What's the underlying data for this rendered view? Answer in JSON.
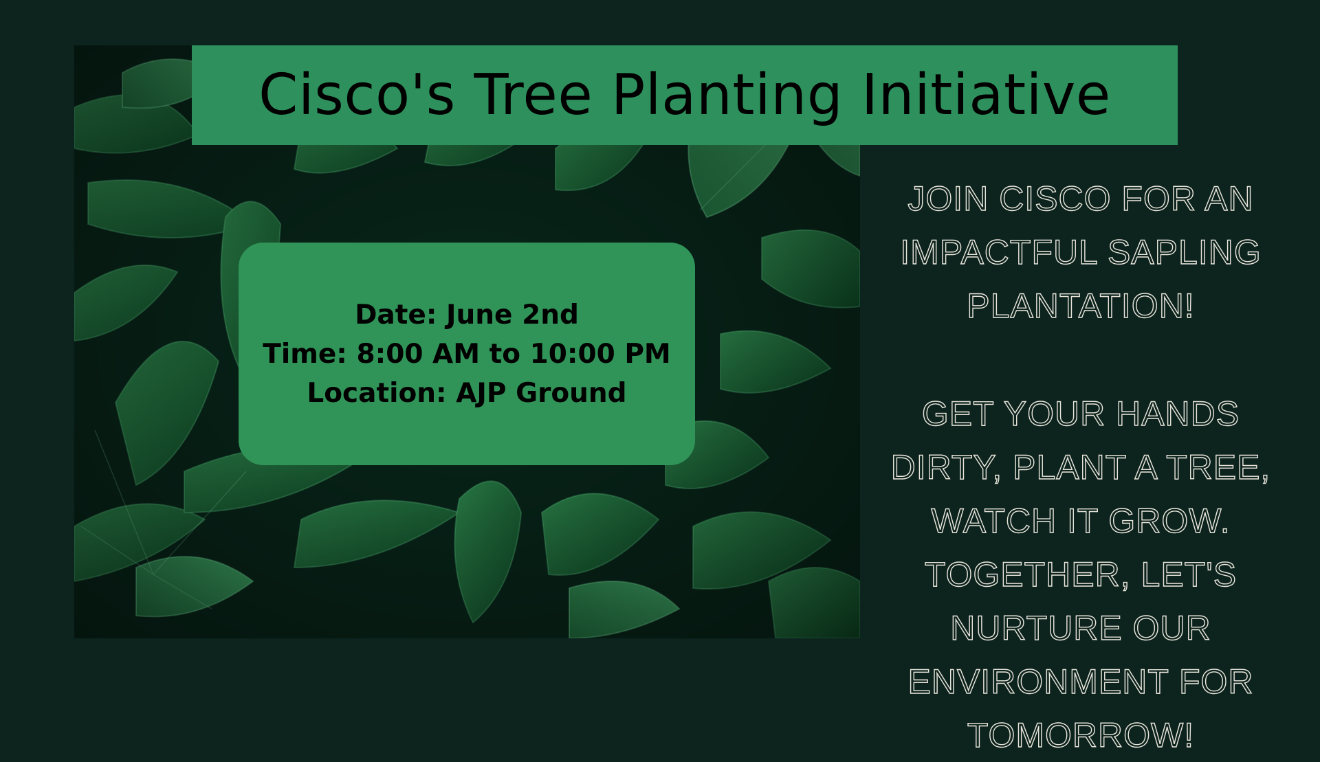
{
  "title": "Cisco's Tree Planting Initiative",
  "details": {
    "date": "Date: June 2nd",
    "time": "Time: 8:00 AM to 10:00 PM",
    "location": "Location: AJP Ground"
  },
  "side": {
    "intro": "JOIN CISCO FOR AN IMPACTFUL SAPLING PLANTATION!",
    "body": "GET YOUR HANDS DIRTY, PLANT A TREE, WATCH IT GROW. TOGETHER, LET'S NURTURE OUR ENVIRONMENT FOR TOMORROW!"
  },
  "colors": {
    "background": "#0c231e",
    "accent_green": "#2e915d",
    "card_green": "#309458",
    "text_outline": "#eae6dc"
  }
}
